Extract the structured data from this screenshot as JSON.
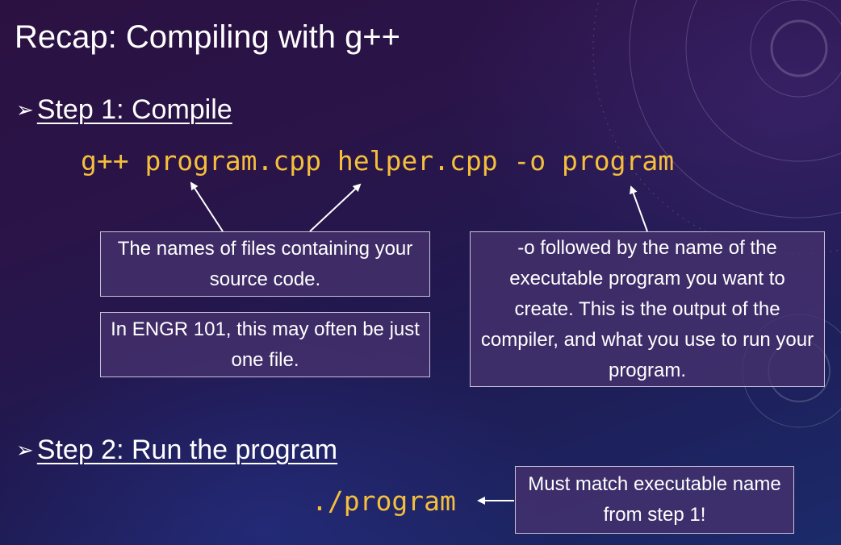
{
  "slide": {
    "title": "Recap: Compiling with g++",
    "step1": {
      "bullet": "➢",
      "label": "Step 1: Compile",
      "command": "g++ program.cpp helper.cpp -o program"
    },
    "callouts": {
      "source_files": "The names of files containing your source code.",
      "one_file_note": "In ENGR 101, this may often be just one file.",
      "output_flag": "-o followed by the name of the executable program you want to create. This is the output of the compiler, and what you use to run your program."
    },
    "step2": {
      "bullet": "➢",
      "label": "Step 2: Run the program",
      "command": "./program",
      "note": "Must match executable name from step 1!"
    }
  },
  "colors": {
    "code": "#f6bf3b",
    "text": "#ffffff",
    "box_fill": "#46326e",
    "box_border": "#c9c1d9"
  }
}
